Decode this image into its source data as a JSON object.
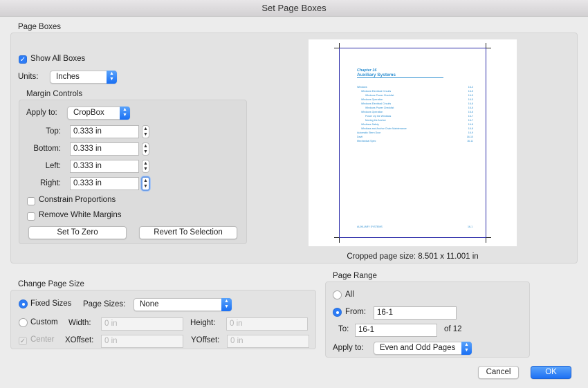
{
  "window": {
    "title": "Set Page Boxes"
  },
  "page_boxes": {
    "group_label": "Page Boxes",
    "show_all_boxes": {
      "label": "Show All Boxes",
      "checked": true
    },
    "units": {
      "label": "Units:",
      "value": "Inches"
    },
    "margin_controls": {
      "group_label": "Margin Controls",
      "apply_to": {
        "label": "Apply to:",
        "value": "CropBox"
      },
      "top": {
        "label": "Top:",
        "value": "0.333 in"
      },
      "bottom": {
        "label": "Bottom:",
        "value": "0.333 in"
      },
      "left": {
        "label": "Left:",
        "value": "0.333 in"
      },
      "right": {
        "label": "Right:",
        "value": "0.333 in"
      },
      "constrain_proportions": {
        "label": "Constrain Proportions",
        "checked": false
      },
      "remove_white_margins": {
        "label": "Remove White Margins",
        "checked": false
      },
      "set_to_zero": "Set To Zero",
      "revert_to_selection": "Revert To Selection"
    },
    "preview": {
      "chapter": "Chapter 16",
      "heading": "Auxiliary Systems",
      "toc": [
        {
          "t": "Windows",
          "p": "16-3",
          "indent": 0
        },
        {
          "t": "Windows Electrical Circuits",
          "p": "16-5",
          "indent": 1
        },
        {
          "t": "Windows Power Checklist",
          "p": "16-5",
          "indent": 2
        },
        {
          "t": "Windows Operation",
          "p": "16-5",
          "indent": 1
        },
        {
          "t": "Windows Electrical Circuits",
          "p": "16-6",
          "indent": 1
        },
        {
          "t": "Windows Power Checklist",
          "p": "16-6",
          "indent": 2
        },
        {
          "t": "Windows Operation",
          "p": "16-6",
          "indent": 1
        },
        {
          "t": "Power Up the Windlass",
          "p": "16-7",
          "indent": 2
        },
        {
          "t": "Moving the Anchor",
          "p": "16-7",
          "indent": 2
        },
        {
          "t": "Windlass Safety",
          "p": "16-8",
          "indent": 1
        },
        {
          "t": "Windlass and Anchor Chain Maintenance",
          "p": "16-8",
          "indent": 1
        },
        {
          "t": "Automatic Stern Door",
          "p": "16-9",
          "indent": 0
        },
        {
          "t": "Davit",
          "p": "16-10",
          "indent": 0
        },
        {
          "t": "Mechanical Spec",
          "p": "16-11",
          "indent": 0
        }
      ],
      "footer_left": "AUXILIARY SYSTEMS",
      "footer_right": "16-1",
      "cropped_size": "Cropped page size: 8.501 x 11.001 in"
    }
  },
  "change_page_size": {
    "group_label": "Change Page Size",
    "fixed_sizes": {
      "label": "Fixed Sizes",
      "selected": true
    },
    "page_sizes": {
      "label": "Page Sizes:",
      "value": "None"
    },
    "custom": {
      "label": "Custom",
      "selected": false
    },
    "width": {
      "label": "Width:",
      "placeholder": "0 in"
    },
    "height": {
      "label": "Height:",
      "placeholder": "0 in"
    },
    "center": {
      "label": "Center",
      "checked": true
    },
    "xoffset": {
      "label": "XOffset:",
      "placeholder": "0 in"
    },
    "yoffset": {
      "label": "YOffset:",
      "placeholder": "0 in"
    }
  },
  "page_range": {
    "group_label": "Page Range",
    "all": {
      "label": "All",
      "selected": false
    },
    "from": {
      "label": "From:",
      "value": "16-1"
    },
    "to": {
      "label": "To:",
      "value": "16-1"
    },
    "of_total": "of 12",
    "apply_to": {
      "label": "Apply to:",
      "value": "Even and Odd Pages"
    }
  },
  "buttons": {
    "cancel": "Cancel",
    "ok": "OK"
  },
  "colors": {
    "accent": "#2d7cf6",
    "preview_text": "#2b8ed1",
    "page_border": "#2a2aa8"
  }
}
